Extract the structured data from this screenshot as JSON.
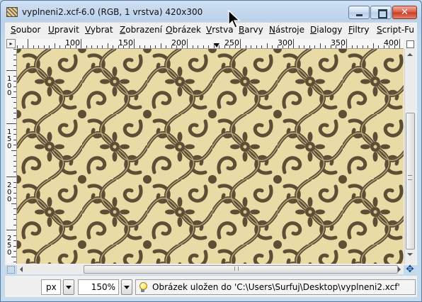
{
  "window": {
    "title": "vyplneni2.xcf-6.0 (RGB, 1 vrstva) 420x300",
    "close_glyph": "✕"
  },
  "menubar": {
    "items": [
      "Soubor",
      "Upravit",
      "Vybrat",
      "Zobrazení",
      "Obrázek",
      "Vrstva",
      "Barvy",
      "Nástroje",
      "Dialogy",
      "Filtry",
      "Script-Fu"
    ]
  },
  "rulers": {
    "horizontal_labels": [
      "100",
      "150",
      "200",
      "250",
      "300",
      "350",
      "400"
    ],
    "vertical_labels": [
      "100",
      "150",
      "200",
      "250"
    ],
    "zoom_corner_icon": "zoom-fit-icon",
    "quickmask_icon": "quickmask-icon",
    "navigate_icon": "navigate-icon",
    "navigate_glyph": "✥"
  },
  "canvas": {
    "pattern": "ornamental-damask",
    "colors": {
      "background": "#e9dba6",
      "ornament": "#5e4e35",
      "highlight": "#b9a77c"
    }
  },
  "statusbar": {
    "unit": "px",
    "zoom": "150%",
    "message": "Obrázek uložen do 'C:\\Users\\Surfuj\\Desktop\\vyplneni2.xcf'",
    "message_icon": "lightbulb-icon"
  }
}
